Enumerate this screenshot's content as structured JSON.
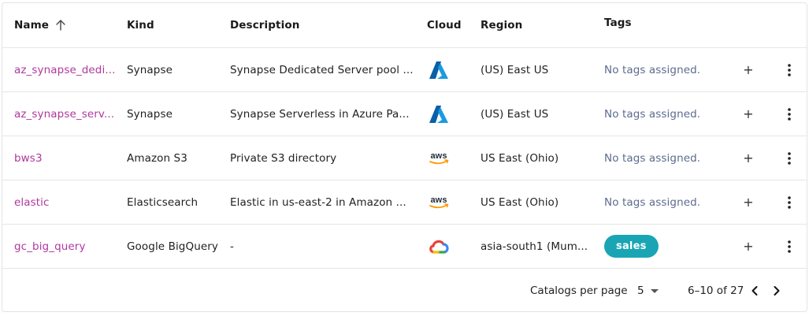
{
  "table": {
    "columns": {
      "name": "Name",
      "kind": "Kind",
      "description": "Description",
      "cloud": "Cloud",
      "region": "Region",
      "tags": "Tags"
    },
    "add_label": "+",
    "rows": [
      {
        "name": "az_synapse_dedi...",
        "kind": "Synapse",
        "description": "Synapse Dedicated Server pool ...",
        "cloud_icon": "azure-icon",
        "region": "(US) East US",
        "tags": "No tags assigned."
      },
      {
        "name": "az_synapse_serv...",
        "kind": "Synapse",
        "description": "Synapse Serverless in Azure Pa...",
        "cloud_icon": "azure-icon",
        "region": "(US) East US",
        "tags": "No tags assigned."
      },
      {
        "name": "bws3",
        "kind": "Amazon S3",
        "description": "Private S3 directory",
        "cloud_icon": "aws-icon",
        "region": "US East (Ohio)",
        "tags": "No tags assigned."
      },
      {
        "name": "elastic",
        "kind": "Elasticsearch",
        "description": "Elastic in us-east-2 in Amazon ...",
        "cloud_icon": "aws-icon",
        "region": "US East (Ohio)",
        "tags": "No tags assigned."
      },
      {
        "name": "gc_big_query",
        "kind": "Google BigQuery",
        "description": "-",
        "cloud_icon": "google-cloud-icon",
        "region": "asia-south1 (Mum...",
        "tag_pill": "sales"
      }
    ]
  },
  "pagination": {
    "per_page_label": "Catalogs per page",
    "per_page_value": "5",
    "range": "6–10 of 27"
  },
  "colors": {
    "name_link": "#b0389f",
    "no_tags": "#5d6b8f",
    "tag_pill_bg": "#1aa5b4",
    "azure_blue": "#0078d4",
    "aws_orange": "#ff9900"
  }
}
